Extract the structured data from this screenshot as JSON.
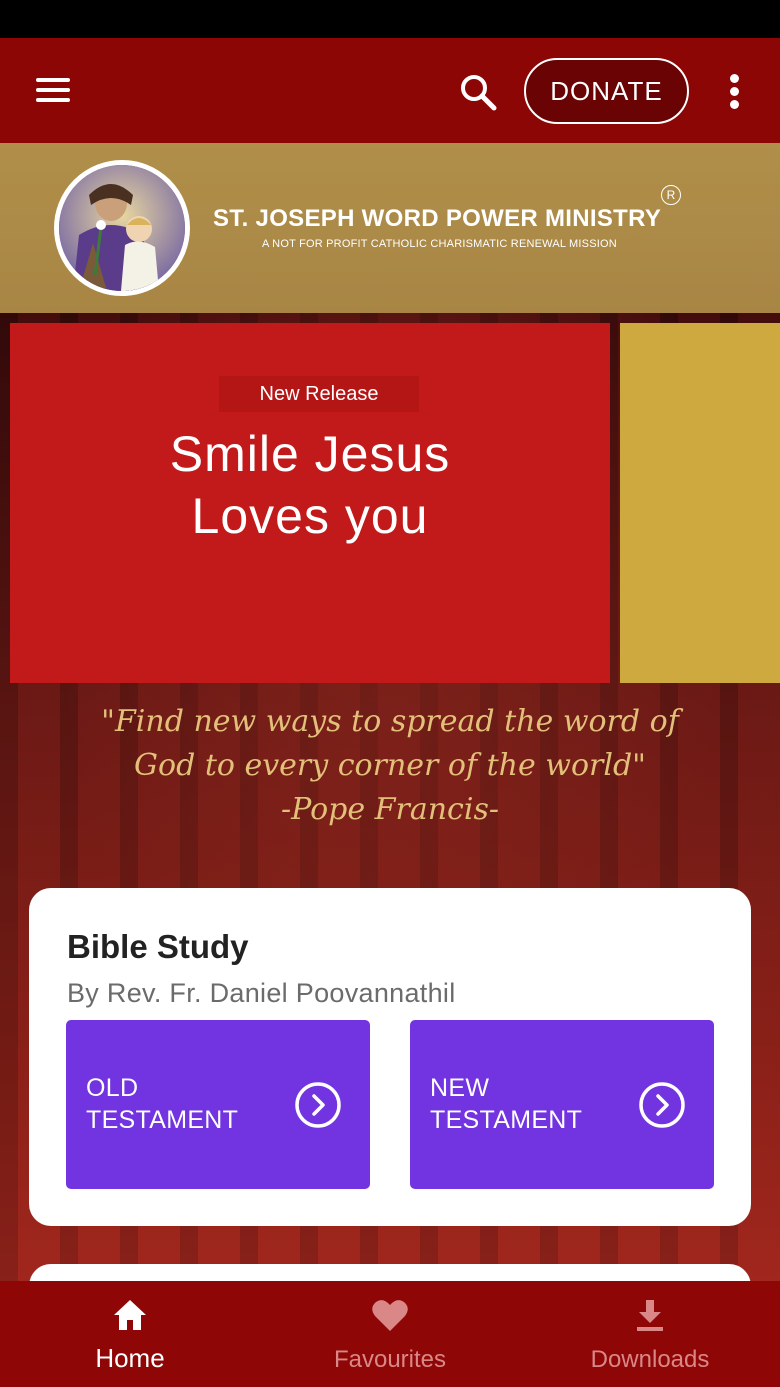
{
  "app_bar": {
    "donate_label": "DONATE"
  },
  "brand": {
    "title": "ST. JOSEPH WORD POWER MINISTRY",
    "subtitle": "A NOT FOR PROFIT CATHOLIC CHARISMATIC RENEWAL MISSION",
    "registered_mark": "R"
  },
  "carousel": {
    "tag": "New Release",
    "title_line1": "Smile Jesus",
    "title_line2": "Loves you"
  },
  "quote": {
    "line1": "\"Find new ways to spread the word of",
    "line2": "God to every corner of the world\"",
    "author": "-Pope Francis-"
  },
  "bible_study": {
    "title": "Bible Study",
    "author": "By Rev. Fr. Daniel Poovannathil",
    "old_line1": "OLD",
    "old_line2": "TESTAMENT",
    "new_line1": "NEW",
    "new_line2": "TESTAMENT"
  },
  "bottom_nav": {
    "home": "Home",
    "favourites": "Favourites",
    "downloads": "Downloads"
  },
  "colors": {
    "app_bar": "#8c0606",
    "brand_banner": "#b08f4a",
    "slide_red": "#c21a1a",
    "slide_gold": "#cda940",
    "testament_purple": "#7233e0",
    "quote_gold": "#e3c07a"
  },
  "icons": {
    "menu": "menu-icon",
    "search": "search-icon",
    "more": "more-vertical-icon",
    "arrow": "chevron-right-circle-icon",
    "home": "home-icon",
    "favourites": "heart-icon",
    "downloads": "download-icon"
  }
}
